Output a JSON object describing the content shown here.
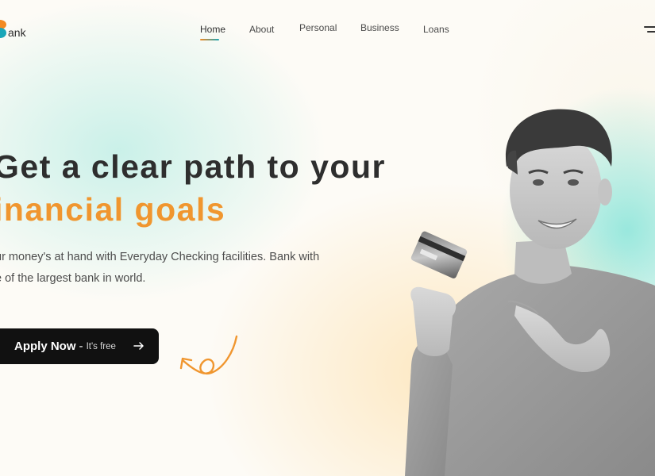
{
  "brand": {
    "logo_text": "ank"
  },
  "nav": {
    "items": [
      {
        "label": "Home",
        "active": true
      },
      {
        "label": "About",
        "active": false
      },
      {
        "label": "Personal",
        "active": false
      },
      {
        "label": "Business",
        "active": false
      },
      {
        "label": "Loans",
        "active": false
      }
    ],
    "menu_icon": "hamburger-menu-icon"
  },
  "hero": {
    "headline_line1": "Get a clear path to your",
    "headline_line2": "inancial goals",
    "description_line1": "ur money's at hand with Everyday Checking facilities. Bank with",
    "description_line2": "e of the largest bank in world.",
    "cta": {
      "label": "Apply Now",
      "separator": "-",
      "sub_label": "It's free",
      "icon": "arrow-right-icon"
    }
  },
  "colors": {
    "accent_orange": "#f0962f",
    "accent_teal": "#1aa6b8",
    "text_dark": "#2e2e2e",
    "button_bg": "#111111"
  }
}
